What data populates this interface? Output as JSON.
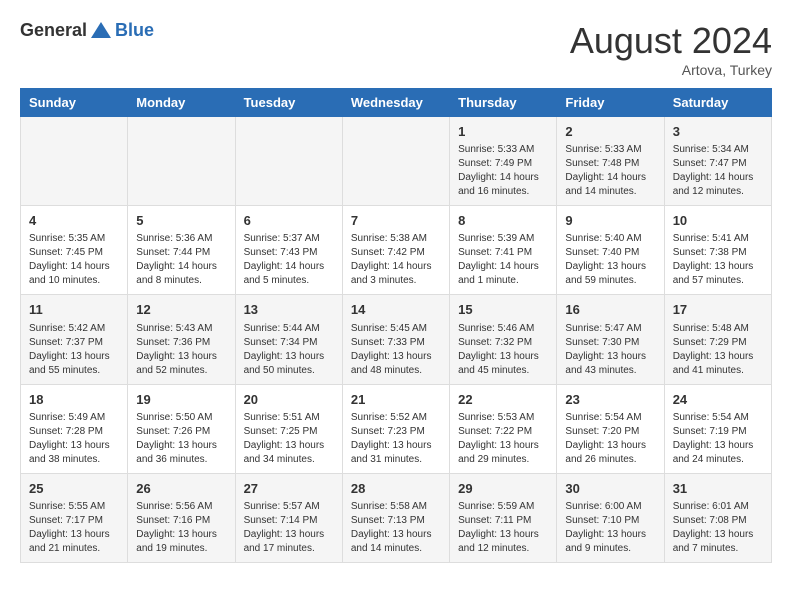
{
  "header": {
    "logo_general": "General",
    "logo_blue": "Blue",
    "month_year": "August 2024",
    "location": "Artova, Turkey"
  },
  "weekdays": [
    "Sunday",
    "Monday",
    "Tuesday",
    "Wednesday",
    "Thursday",
    "Friday",
    "Saturday"
  ],
  "weeks": [
    [
      {
        "day": "",
        "content": ""
      },
      {
        "day": "",
        "content": ""
      },
      {
        "day": "",
        "content": ""
      },
      {
        "day": "",
        "content": ""
      },
      {
        "day": "1",
        "content": "Sunrise: 5:33 AM\nSunset: 7:49 PM\nDaylight: 14 hours\nand 16 minutes."
      },
      {
        "day": "2",
        "content": "Sunrise: 5:33 AM\nSunset: 7:48 PM\nDaylight: 14 hours\nand 14 minutes."
      },
      {
        "day": "3",
        "content": "Sunrise: 5:34 AM\nSunset: 7:47 PM\nDaylight: 14 hours\nand 12 minutes."
      }
    ],
    [
      {
        "day": "4",
        "content": "Sunrise: 5:35 AM\nSunset: 7:45 PM\nDaylight: 14 hours\nand 10 minutes."
      },
      {
        "day": "5",
        "content": "Sunrise: 5:36 AM\nSunset: 7:44 PM\nDaylight: 14 hours\nand 8 minutes."
      },
      {
        "day": "6",
        "content": "Sunrise: 5:37 AM\nSunset: 7:43 PM\nDaylight: 14 hours\nand 5 minutes."
      },
      {
        "day": "7",
        "content": "Sunrise: 5:38 AM\nSunset: 7:42 PM\nDaylight: 14 hours\nand 3 minutes."
      },
      {
        "day": "8",
        "content": "Sunrise: 5:39 AM\nSunset: 7:41 PM\nDaylight: 14 hours\nand 1 minute."
      },
      {
        "day": "9",
        "content": "Sunrise: 5:40 AM\nSunset: 7:40 PM\nDaylight: 13 hours\nand 59 minutes."
      },
      {
        "day": "10",
        "content": "Sunrise: 5:41 AM\nSunset: 7:38 PM\nDaylight: 13 hours\nand 57 minutes."
      }
    ],
    [
      {
        "day": "11",
        "content": "Sunrise: 5:42 AM\nSunset: 7:37 PM\nDaylight: 13 hours\nand 55 minutes."
      },
      {
        "day": "12",
        "content": "Sunrise: 5:43 AM\nSunset: 7:36 PM\nDaylight: 13 hours\nand 52 minutes."
      },
      {
        "day": "13",
        "content": "Sunrise: 5:44 AM\nSunset: 7:34 PM\nDaylight: 13 hours\nand 50 minutes."
      },
      {
        "day": "14",
        "content": "Sunrise: 5:45 AM\nSunset: 7:33 PM\nDaylight: 13 hours\nand 48 minutes."
      },
      {
        "day": "15",
        "content": "Sunrise: 5:46 AM\nSunset: 7:32 PM\nDaylight: 13 hours\nand 45 minutes."
      },
      {
        "day": "16",
        "content": "Sunrise: 5:47 AM\nSunset: 7:30 PM\nDaylight: 13 hours\nand 43 minutes."
      },
      {
        "day": "17",
        "content": "Sunrise: 5:48 AM\nSunset: 7:29 PM\nDaylight: 13 hours\nand 41 minutes."
      }
    ],
    [
      {
        "day": "18",
        "content": "Sunrise: 5:49 AM\nSunset: 7:28 PM\nDaylight: 13 hours\nand 38 minutes."
      },
      {
        "day": "19",
        "content": "Sunrise: 5:50 AM\nSunset: 7:26 PM\nDaylight: 13 hours\nand 36 minutes."
      },
      {
        "day": "20",
        "content": "Sunrise: 5:51 AM\nSunset: 7:25 PM\nDaylight: 13 hours\nand 34 minutes."
      },
      {
        "day": "21",
        "content": "Sunrise: 5:52 AM\nSunset: 7:23 PM\nDaylight: 13 hours\nand 31 minutes."
      },
      {
        "day": "22",
        "content": "Sunrise: 5:53 AM\nSunset: 7:22 PM\nDaylight: 13 hours\nand 29 minutes."
      },
      {
        "day": "23",
        "content": "Sunrise: 5:54 AM\nSunset: 7:20 PM\nDaylight: 13 hours\nand 26 minutes."
      },
      {
        "day": "24",
        "content": "Sunrise: 5:54 AM\nSunset: 7:19 PM\nDaylight: 13 hours\nand 24 minutes."
      }
    ],
    [
      {
        "day": "25",
        "content": "Sunrise: 5:55 AM\nSunset: 7:17 PM\nDaylight: 13 hours\nand 21 minutes."
      },
      {
        "day": "26",
        "content": "Sunrise: 5:56 AM\nSunset: 7:16 PM\nDaylight: 13 hours\nand 19 minutes."
      },
      {
        "day": "27",
        "content": "Sunrise: 5:57 AM\nSunset: 7:14 PM\nDaylight: 13 hours\nand 17 minutes."
      },
      {
        "day": "28",
        "content": "Sunrise: 5:58 AM\nSunset: 7:13 PM\nDaylight: 13 hours\nand 14 minutes."
      },
      {
        "day": "29",
        "content": "Sunrise: 5:59 AM\nSunset: 7:11 PM\nDaylight: 13 hours\nand 12 minutes."
      },
      {
        "day": "30",
        "content": "Sunrise: 6:00 AM\nSunset: 7:10 PM\nDaylight: 13 hours\nand 9 minutes."
      },
      {
        "day": "31",
        "content": "Sunrise: 6:01 AM\nSunset: 7:08 PM\nDaylight: 13 hours\nand 7 minutes."
      }
    ]
  ]
}
